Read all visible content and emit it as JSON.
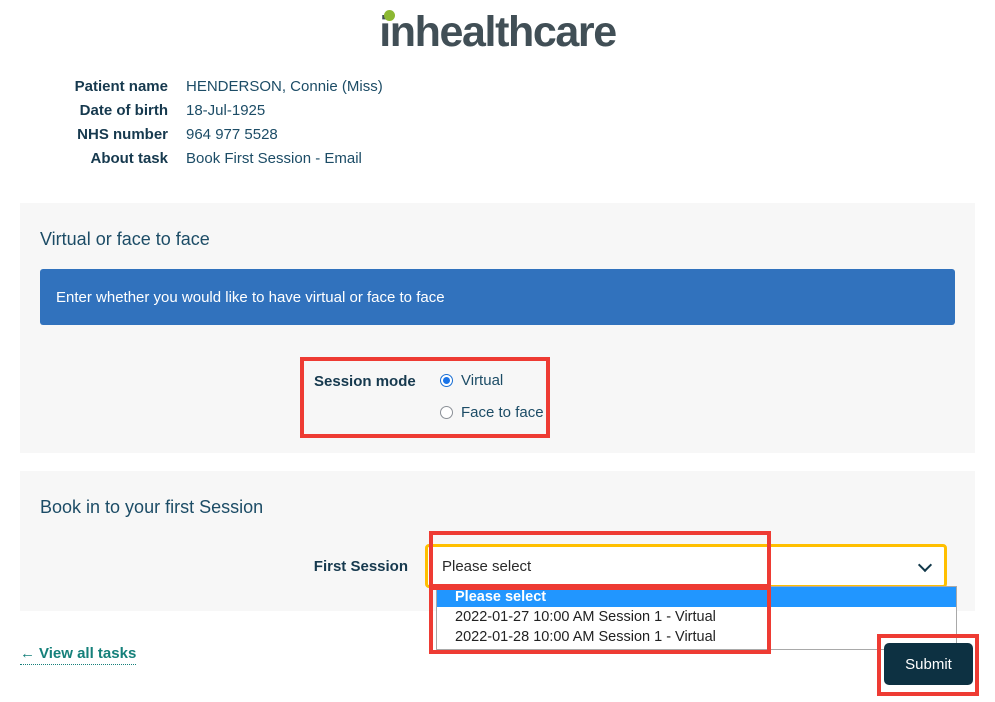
{
  "brand": {
    "logo_text": "inhealthcare",
    "logo_color": "#414f56",
    "dot_color": "#8cb832"
  },
  "patient": {
    "rows": [
      {
        "label": "Patient name",
        "value": "HENDERSON, Connie (Miss)"
      },
      {
        "label": "Date of birth",
        "value": "18-Jul-1925"
      },
      {
        "label": "NHS number",
        "value": "964 977 5528"
      },
      {
        "label": "About task",
        "value": "Book First Session - Email"
      }
    ]
  },
  "section_mode": {
    "title": "Virtual or face to face",
    "banner_text": "Enter whether you would like to have virtual or face to face",
    "banner_color": "#3172bd",
    "field_label": "Session mode",
    "options": [
      {
        "label": "Virtual",
        "selected": true
      },
      {
        "label": "Face to face",
        "selected": false
      }
    ]
  },
  "section_booking": {
    "title": "Book in to your first Session",
    "field_label": "First Session",
    "select_value": "Please select",
    "dropdown_open": true,
    "options": [
      {
        "label": "Please select",
        "highlighted": true
      },
      {
        "label": "2022-01-27 10:00 AM Session 1 - Virtual",
        "highlighted": false
      },
      {
        "label": "2022-01-28 10:00 AM Session 1 - Virtual",
        "highlighted": false
      }
    ]
  },
  "footer": {
    "view_all_label": "View all tasks",
    "back_arrow": "←",
    "submit_label": "Submit",
    "submit_color": "#0d3142",
    "link_color": "#15807a"
  },
  "annotations": {
    "highlight_color": "#ee3b33",
    "focus_ring_color": "#ffbf00"
  }
}
